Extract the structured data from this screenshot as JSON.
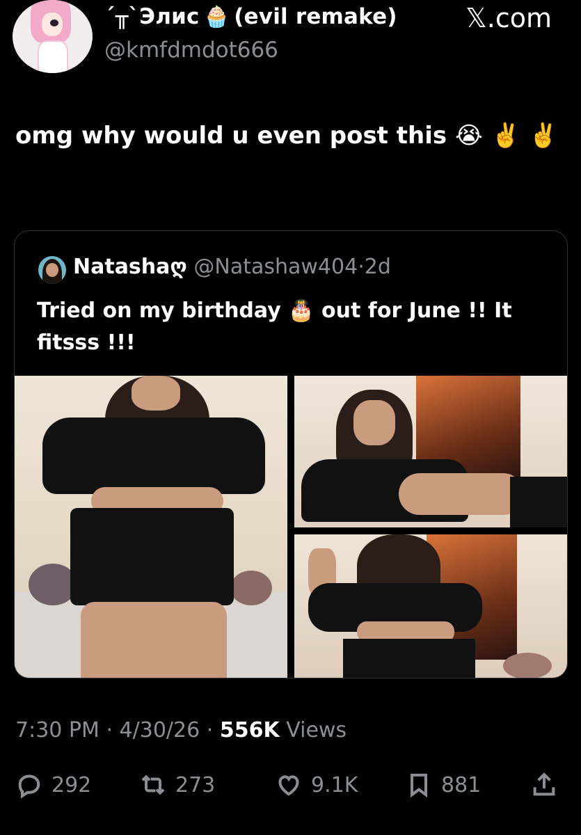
{
  "author": {
    "display_name_prefix": "´╥`Элис",
    "display_name_suffix": "(evil remake)",
    "handle": "@kmfdmdot666",
    "emoji": "🧁"
  },
  "site_label": "𝕏.com",
  "tweet": {
    "text": "omg why would u even post this 😭 ✌️ ✌️"
  },
  "quoted": {
    "name": "Natasha",
    "name_emoji": "ღ",
    "handle": "@Natashaw404",
    "separator": "·",
    "time": "2d",
    "text": "Tried on my birthday 🎂 out for June !! It fitsss !!!"
  },
  "meta": {
    "time": "7:30 PM",
    "sep1": "·",
    "date": "4/30/26",
    "sep2": "·",
    "views_count": "556K",
    "views_label": "Views"
  },
  "actions": {
    "replies": "292",
    "reposts": "273",
    "likes": "9.1K",
    "bookmarks": "881"
  },
  "icons": {
    "reply": "speech-bubble-icon",
    "repost": "repost-arrows-icon",
    "like": "heart-icon",
    "bookmark": "bookmark-icon",
    "share": "share-upload-icon"
  }
}
